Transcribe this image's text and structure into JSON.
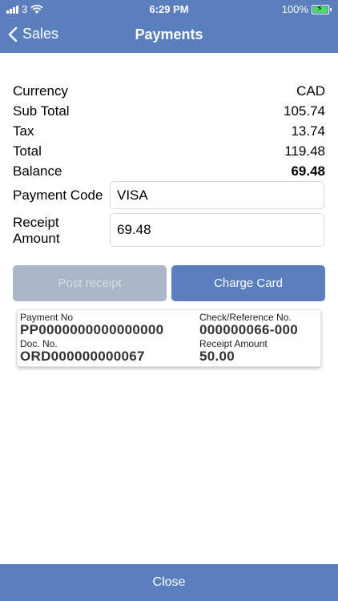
{
  "status_bar": {
    "carrier": "3",
    "time": "6:29 PM",
    "battery": "100%"
  },
  "nav": {
    "back_label": "Sales",
    "title": "Payments"
  },
  "summary": [
    {
      "label": "Currency",
      "value": "CAD",
      "bold": false
    },
    {
      "label": "Sub Total",
      "value": "105.74",
      "bold": false
    },
    {
      "label": "Tax",
      "value": "13.74",
      "bold": false
    },
    {
      "label": "Total",
      "value": "119.48",
      "bold": false
    },
    {
      "label": "Balance",
      "value": "69.48",
      "bold": true
    }
  ],
  "payment_code": {
    "label": "Payment Code",
    "value": "VISA"
  },
  "receipt_amount": {
    "label_line1": "Receipt",
    "label_line2": "Amount",
    "value": "69.48"
  },
  "buttons": {
    "post_receipt": "Post receipt",
    "charge_card": "Charge Card",
    "close": "Close"
  },
  "receipt_card": {
    "payment_no_label": "Payment No",
    "payment_no": "PP0000000000000000",
    "check_ref_label": "Check/Reference No.",
    "check_ref": "000000066-000",
    "doc_no_label": "Doc. No.",
    "doc_no": "ORD000000000067",
    "receipt_amount_label": "Receipt Amount",
    "receipt_amount": "50.00"
  },
  "colors": {
    "accent": "#5b7fbd",
    "disabled": "#a9b6c7",
    "battery": "#4cd964"
  }
}
